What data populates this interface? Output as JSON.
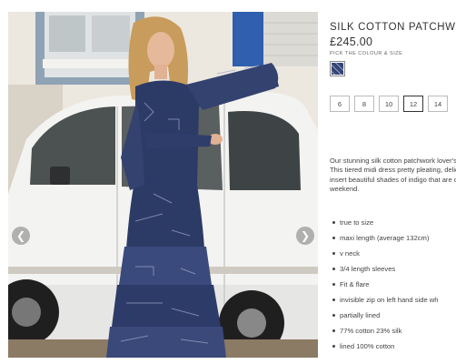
{
  "gallery": {
    "prev_icon": "chevron-left-icon",
    "next_icon": "chevron-right-icon",
    "prev_glyph": "❮",
    "next_glyph": "❯"
  },
  "product": {
    "title": "SILK COTTON PATCHWORK",
    "price": "£245.00",
    "pick_label": "PICK THE COLOUR & SIZE",
    "sizes": [
      "6",
      "8",
      "10",
      "12",
      "14"
    ],
    "selected_size": "12",
    "description": "Our stunning silk cotton patchwork lover's dream. This tiered midi dress pretty pleating, delicate lace insert beautiful shades of indigo that are out at the weekend.",
    "features": [
      "true to size",
      "maxi length (average 132cm)",
      "v neck",
      "3/4 length sleeves",
      "Fit & flare",
      "invisible zip on left hand side wh",
      "partially lined",
      "77% cotton 23% silk",
      "lined 100% cotton"
    ]
  },
  "colors": {
    "text": "#333333",
    "swatch": "#2e3f6e",
    "door_blue": "#2f5fae"
  }
}
